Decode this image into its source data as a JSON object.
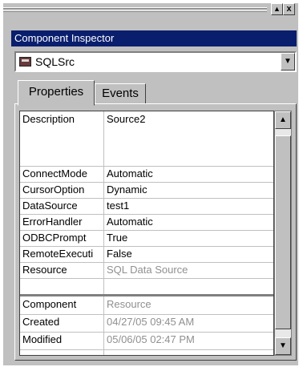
{
  "window": {
    "title": "Component Inspector"
  },
  "toolbar": {
    "restore_icon": "up-arrow-icon",
    "close_label": "x"
  },
  "component_select": {
    "value": "SQLSrc",
    "icon": "component-icon"
  },
  "tabs": [
    {
      "label": "Properties",
      "active": true
    },
    {
      "label": "Events",
      "active": false
    }
  ],
  "properties": [
    {
      "name": "Description",
      "value": "Source2",
      "dim": false
    },
    {
      "name": "ConnectMode",
      "value": "Automatic",
      "dim": false
    },
    {
      "name": "CursorOption",
      "value": "Dynamic",
      "dim": false
    },
    {
      "name": "DataSource",
      "value": "test1",
      "dim": false
    },
    {
      "name": "ErrorHandler",
      "value": "Automatic",
      "dim": false
    },
    {
      "name": "ODBCPrompt",
      "value": "True",
      "dim": false
    },
    {
      "name": "RemoteExecuti",
      "value": "False",
      "dim": false
    },
    {
      "name": "Resource",
      "value": "SQL Data Source",
      "dim": true
    }
  ],
  "info": [
    {
      "name": "Component",
      "value": "Resource",
      "dim": true
    },
    {
      "name": "Created",
      "value": "04/27/05 09:45 AM",
      "dim": true
    },
    {
      "name": "Modified",
      "value": "05/06/05 02:47 PM",
      "dim": true
    }
  ],
  "scrollbar": {
    "up_icon": "scroll-up-icon",
    "down_icon": "scroll-down-icon"
  }
}
